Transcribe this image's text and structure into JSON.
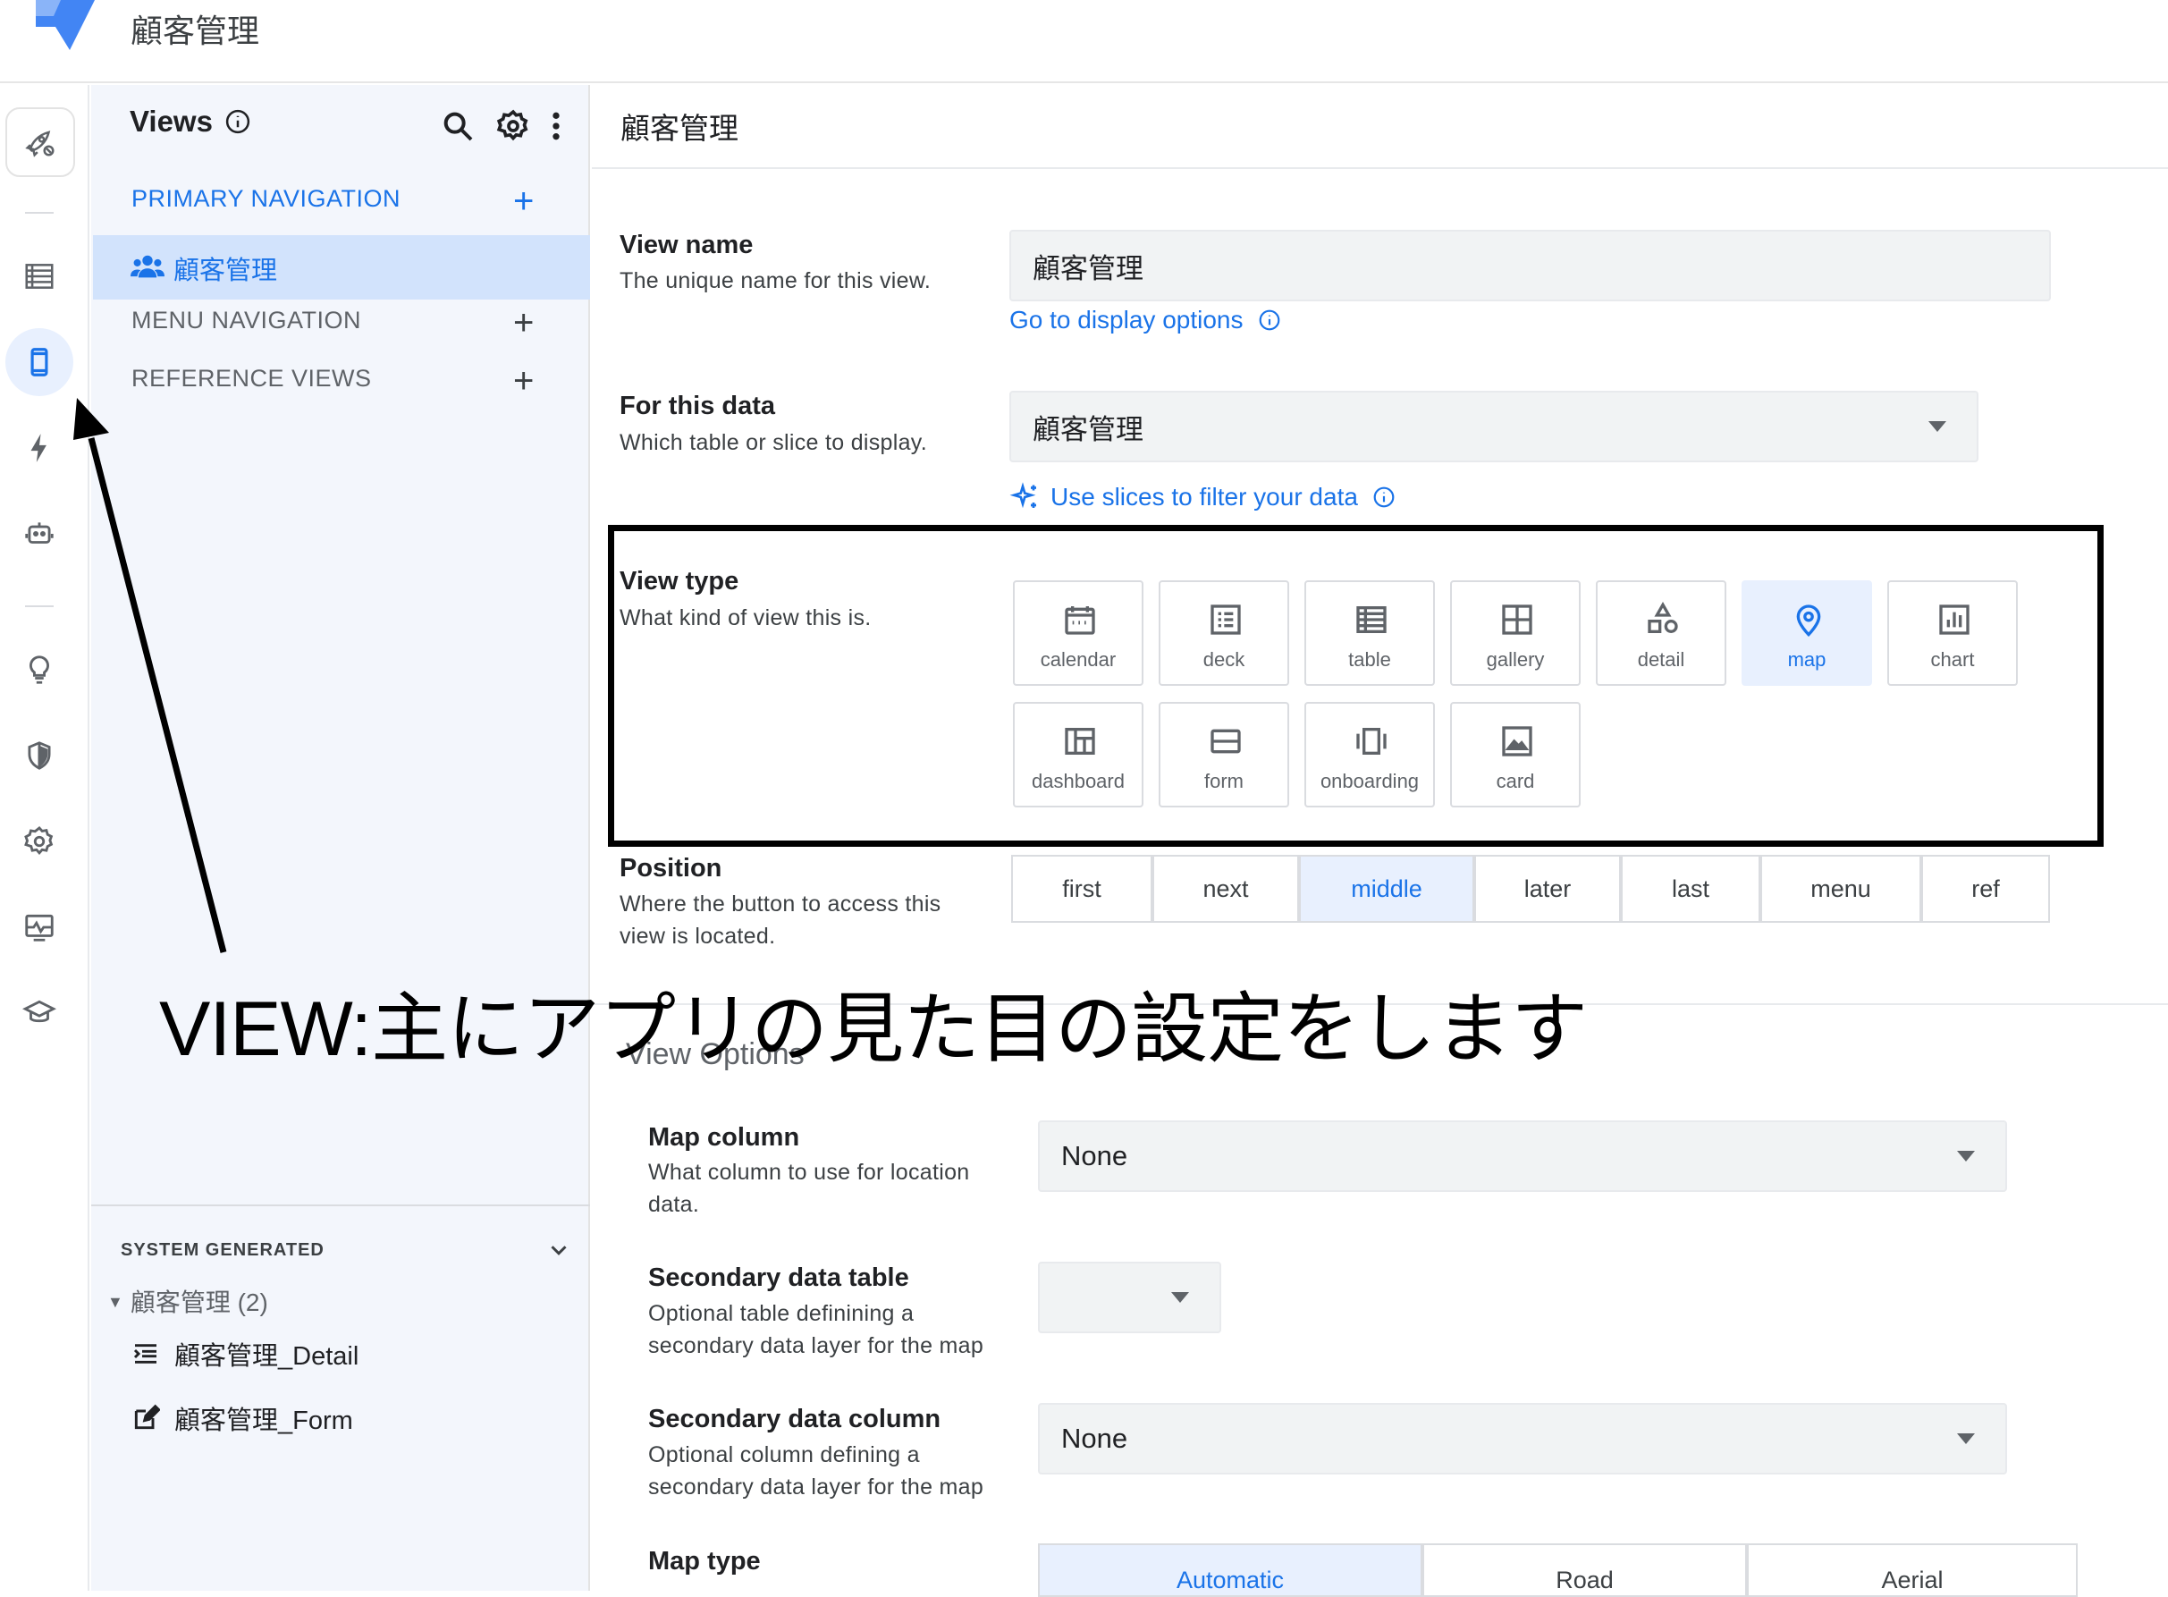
{
  "app": {
    "title": "顧客管理"
  },
  "colors": {
    "accent": "#1a73e8",
    "active_bg": "#d2e3fc",
    "panel_bg": "#f3f6fc"
  },
  "rail": {
    "items": [
      {
        "icon": "rocket-icon"
      },
      {
        "icon": "table-data-icon"
      },
      {
        "icon": "phone-icon",
        "active": true
      },
      {
        "icon": "bolt-icon"
      },
      {
        "icon": "robot-icon"
      },
      {
        "icon": "lightbulb-icon"
      },
      {
        "icon": "shield-icon"
      },
      {
        "icon": "gear-icon"
      },
      {
        "icon": "monitor-icon"
      },
      {
        "icon": "graduation-icon"
      }
    ]
  },
  "views_panel": {
    "title": "Views",
    "primary_nav_label": "PRIMARY NAVIGATION",
    "primary_item": "顧客管理",
    "menu_nav_label": "MENU NAVIGATION",
    "reference_views_label": "REFERENCE VIEWS",
    "system_generated_label": "SYSTEM GENERATED",
    "tree_group": "顧客管理 (2)",
    "tree_items": [
      "顧客管理_Detail",
      "顧客管理_Form"
    ],
    "plus": "+"
  },
  "main": {
    "title": "顧客管理",
    "view_name": {
      "label": "View name",
      "desc": "The unique name for this view.",
      "value": "顧客管理",
      "link": "Go to display options"
    },
    "for_data": {
      "label": "For this data",
      "desc": "Which table or slice to display.",
      "value": "顧客管理",
      "link": "Use slices to filter your data"
    },
    "view_type": {
      "label": "View type",
      "desc": "What kind of view this is.",
      "options": [
        "calendar",
        "deck",
        "table",
        "gallery",
        "detail",
        "map",
        "chart",
        "dashboard",
        "form",
        "onboarding",
        "card"
      ],
      "selected": "map"
    },
    "position": {
      "label": "Position",
      "desc": "Where the button to access this view is located.",
      "options": [
        "first",
        "next",
        "middle",
        "later",
        "last",
        "menu",
        "ref"
      ],
      "selected": "middle"
    },
    "view_options_title": "View Options",
    "map_column": {
      "label": "Map column",
      "desc": "What column to use for location data.",
      "value": "None"
    },
    "secondary_table": {
      "label": "Secondary data table",
      "desc": "Optional table definining a secondary data layer for the map",
      "value": ""
    },
    "secondary_column": {
      "label": "Secondary data column",
      "desc": "Optional column defining a secondary data layer for the map",
      "value": "None"
    },
    "map_type": {
      "label": "Map type",
      "options": [
        "Automatic",
        "Road",
        "Aerial"
      ],
      "selected": "Automatic"
    }
  },
  "annotation": "VIEW:主にアプリの見た目の設定をします"
}
